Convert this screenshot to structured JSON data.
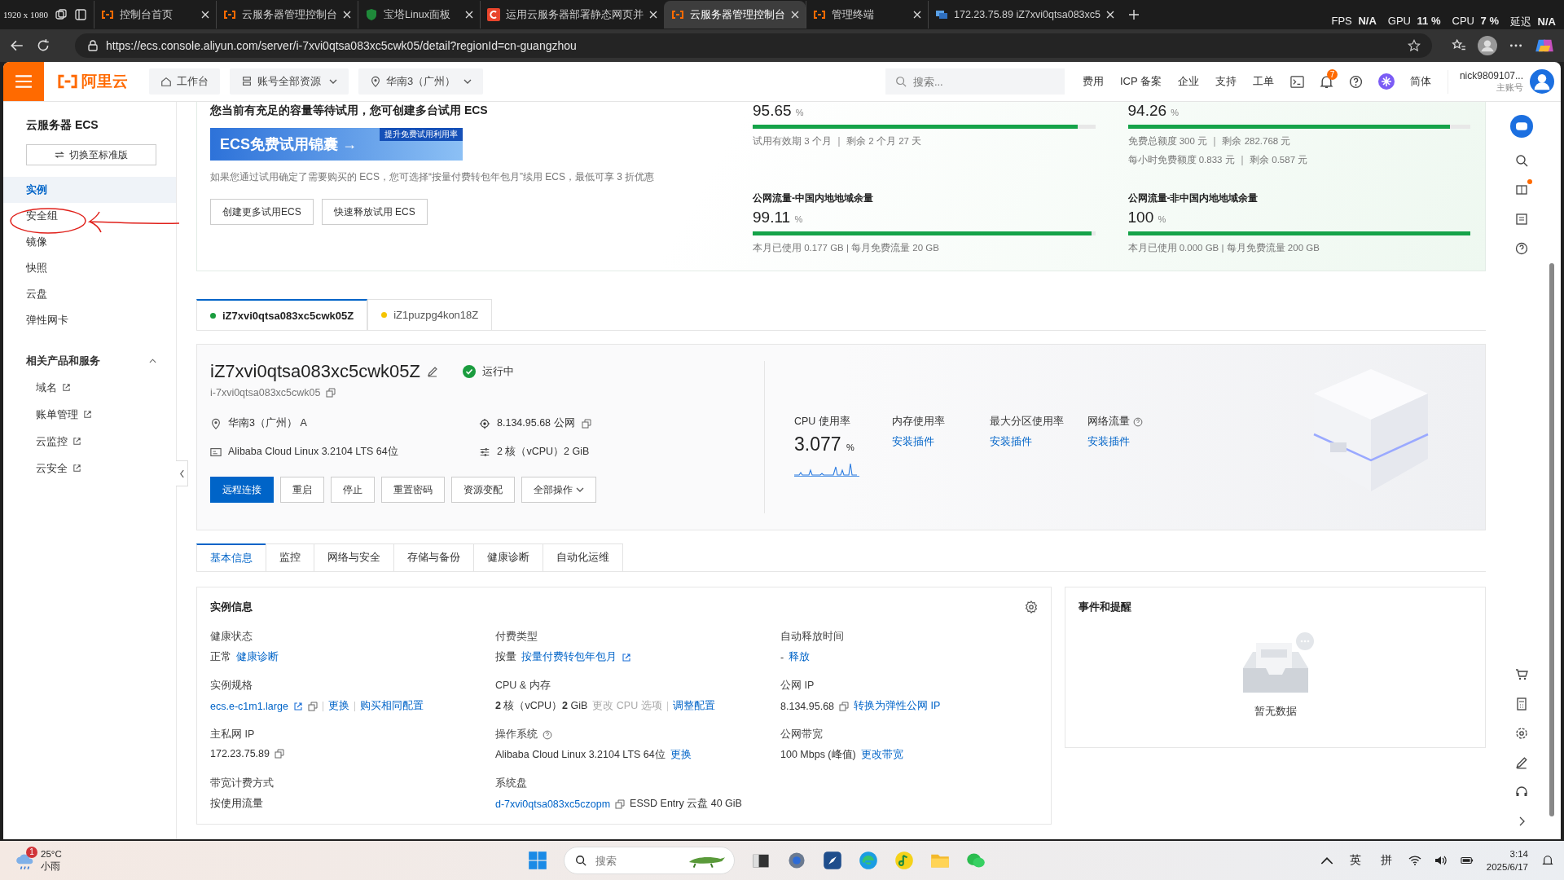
{
  "browser": {
    "size_overlay": "1920 x 1080",
    "tabs": [
      {
        "title": "控制台首页",
        "kind": "aliyun",
        "selected": false
      },
      {
        "title": "云服务器管理控制台",
        "kind": "aliyun",
        "selected": false
      },
      {
        "title": "宝塔Linux面板",
        "kind": "shield",
        "selected": false
      },
      {
        "title": "运用云服务器部署静态网页并",
        "kind": "letter",
        "selected": false
      },
      {
        "title": "云服务器管理控制台",
        "kind": "aliyun",
        "selected": true
      },
      {
        "title": "管理终端",
        "kind": "aliyun",
        "selected": false
      },
      {
        "title": "172.23.75.89 iZ7xvi0qtsa083xc5",
        "kind": "remote",
        "selected": false
      }
    ],
    "url": "https://ecs.console.aliyun.com/server/i-7xvi0qtsa083xc5cwk05/detail?regionId=cn-guangzhou",
    "stats": [
      {
        "label": "FPS",
        "value": "N/A"
      },
      {
        "label": "GPU",
        "value": "11 %"
      },
      {
        "label": "CPU",
        "value": "7 %"
      },
      {
        "label": "延迟",
        "value": "N/A"
      }
    ]
  },
  "console_header": {
    "logo": "阿里云",
    "nav": [
      {
        "label": "工作台",
        "kind": "home",
        "dropdown": false
      },
      {
        "label": "账号全部资源",
        "kind": "stack",
        "dropdown": true
      },
      {
        "label": "华南3（广州）",
        "kind": "pin",
        "dropdown": true
      }
    ],
    "search_placeholder": "搜索...",
    "links": [
      "费用",
      "ICP 备案",
      "企业",
      "支持",
      "工单"
    ],
    "notification_count": "7",
    "language": "简体",
    "account": "nick9809107...",
    "account_type": "主账号"
  },
  "sidebar": {
    "title": "云服务器 ECS",
    "switch_button": "切换至标准版",
    "items": [
      {
        "label": "实例",
        "selected": true
      },
      {
        "label": "安全组",
        "selected": false
      },
      {
        "label": "镜像",
        "selected": false
      },
      {
        "label": "快照",
        "selected": false
      },
      {
        "label": "云盘",
        "selected": false
      },
      {
        "label": "弹性网卡",
        "selected": false
      }
    ],
    "related": {
      "title": "相关产品和服务",
      "expanded": true,
      "links": [
        "域名",
        "账单管理",
        "云监控",
        "云安全"
      ]
    }
  },
  "trial": {
    "heading": "您当前有充足的容量等待试用，您可创建多台试用 ECS",
    "banner": "ECS免费试用锦囊 →",
    "banner_tag": "提升免费试用利用率",
    "note": "如果您通过试用确定了需要购买的 ECS，您可选择“按量付费转包年包月”续用 ECS，最低可享 3 折优惠",
    "buttons": [
      "创建更多试用ECS",
      "快速释放试用 ECS"
    ],
    "meters": [
      {
        "value": "95.65",
        "unit": "%",
        "level": 0.95,
        "notes": [
          "试用有效期 3 个月 ｜ 剩余 2 个月 27 天"
        ]
      },
      {
        "value": "94.26",
        "unit": "%",
        "level": 0.94,
        "notes": [
          "免费总额度 300 元 ｜ 剩余 282.768 元",
          "每小时免费额度 0.833 元 ｜ 剩余 0.587 元"
        ]
      },
      {
        "title": "公网流量-中国内地地域余量",
        "value": "99.11",
        "unit": "%",
        "level": 0.99,
        "notes": [
          "本月已使用 0.177 GB | 每月免费流量 20 GB"
        ]
      },
      {
        "title": "公网流量-非中国内地地域余量",
        "value": "100",
        "unit": "%",
        "level": 1,
        "notes": [
          "本月已使用 0.000 GB | 每月免费流量 200 GB"
        ]
      }
    ]
  },
  "instance_tabs": [
    {
      "label": "iZ7xvi0qtsa083xc5cwk05Z",
      "color": "#1a9c3e",
      "selected": true
    },
    {
      "label": "iZ1puzpg4kon18Z",
      "color": "#f5c400",
      "selected": false
    }
  ],
  "instance": {
    "name": "iZ7xvi0qtsa083xc5cwk05Z",
    "status": "运行中",
    "id": "i-7xvi0qtsa083xc5cwk05",
    "props": [
      {
        "kind": "pin",
        "text": "华南3（广州） A",
        "copy": false
      },
      {
        "kind": "target",
        "text": "8.134.95.68 公网",
        "copy": true
      },
      {
        "kind": "os",
        "text": "Alibaba Cloud Linux 3.2104 LTS 64位",
        "copy": false
      },
      {
        "kind": "sliders",
        "text": "2 核（vCPU）2 GiB",
        "copy": false
      }
    ],
    "actions": [
      {
        "label": "远程连接",
        "kind": "primary"
      },
      {
        "label": "重启",
        "kind": "normal"
      },
      {
        "label": "停止",
        "kind": "normal"
      },
      {
        "label": "重置密码",
        "kind": "normal"
      },
      {
        "label": "资源变配",
        "kind": "normal"
      },
      {
        "label": "全部操作",
        "kind": "dropdown"
      }
    ],
    "metrics": [
      {
        "label": "CPU 使用率",
        "kind": "value",
        "value": "3.077",
        "unit": "%",
        "help": false
      },
      {
        "label": "内存使用率",
        "kind": "link",
        "link": "安装插件",
        "help": false
      },
      {
        "label": "最大分区使用率",
        "kind": "link",
        "link": "安装插件",
        "help": false
      },
      {
        "label": "网络流量",
        "kind": "link",
        "link": "安装插件",
        "help": true
      }
    ]
  },
  "detail_tabs": [
    {
      "label": "基本信息",
      "selected": true
    },
    {
      "label": "监控",
      "selected": false
    },
    {
      "label": "网络与安全",
      "selected": false
    },
    {
      "label": "存储与备份",
      "selected": false
    },
    {
      "label": "健康诊断",
      "selected": false
    },
    {
      "label": "自动化运维",
      "selected": false
    }
  ],
  "info": {
    "title": "实例信息",
    "fields": [
      {
        "label": "健康状态",
        "help": false,
        "parts": [
          {
            "kind": "text",
            "text": "正常"
          },
          {
            "kind": "link",
            "text": "健康诊断"
          }
        ]
      },
      {
        "label": "付费类型",
        "help": false,
        "parts": [
          {
            "kind": "text",
            "text": "按量"
          },
          {
            "kind": "link",
            "text": "按量付费转包年包月",
            "external": true
          }
        ]
      },
      {
        "label": "自动释放时间",
        "help": false,
        "parts": [
          {
            "kind": "text",
            "text": "-"
          },
          {
            "kind": "link",
            "text": "释放"
          }
        ]
      },
      {
        "label": "实例规格",
        "help": false,
        "parts": [
          {
            "kind": "link",
            "text": "ecs.e-c1m1.large",
            "external": true,
            "copy": true
          },
          {
            "kind": "link",
            "text": "更换",
            "divider_before": true
          },
          {
            "kind": "link",
            "text": "购买相同配置",
            "divider_before": true
          }
        ]
      },
      {
        "label": "CPU & 内存",
        "help": false,
        "parts": [
          {
            "kind": "text",
            "text": "**2** 核（vCPU）**2** GiB"
          },
          {
            "kind": "muted",
            "text": "更改 CPU 选项"
          },
          {
            "kind": "link",
            "text": "调整配置",
            "divider_before": true
          }
        ]
      },
      {
        "label": "公网 IP",
        "help": false,
        "parts": [
          {
            "kind": "text",
            "text": "8.134.95.68",
            "copy": true
          },
          {
            "kind": "link",
            "text": "转换为弹性公网 IP"
          }
        ]
      },
      {
        "label": "主私网 IP",
        "help": false,
        "parts": [
          {
            "kind": "text",
            "text": "172.23.75.89",
            "copy": true
          }
        ]
      },
      {
        "label": "操作系统",
        "help": true,
        "parts": [
          {
            "kind": "text",
            "text": "Alibaba Cloud Linux 3.2104 LTS 64位"
          },
          {
            "kind": "link",
            "text": "更换"
          }
        ]
      },
      {
        "label": "公网带宽",
        "help": false,
        "parts": [
          {
            "kind": "text",
            "text": "100 Mbps (峰值)"
          },
          {
            "kind": "link",
            "text": "更改带宽"
          }
        ]
      },
      {
        "label": "带宽计费方式",
        "help": false,
        "parts": [
          {
            "kind": "text",
            "text": "按使用流量"
          }
        ]
      },
      {
        "label": "系统盘",
        "help": false,
        "parts": [
          {
            "kind": "link",
            "text": "d-7xvi0qtsa083xc5czopm",
            "copy": true
          },
          {
            "kind": "text",
            "text": "ESSD Entry 云盘  40 GiB"
          }
        ]
      }
    ]
  },
  "events": {
    "title": "事件和提醒",
    "empty": "暂无数据"
  },
  "taskbar": {
    "weather_badge": "1",
    "temperature": "25°C",
    "weather": "小雨",
    "search_placeholder": "搜索",
    "tray_inputs": [
      "英",
      "拼"
    ],
    "time": "3:14",
    "date": "2025/6/17"
  }
}
